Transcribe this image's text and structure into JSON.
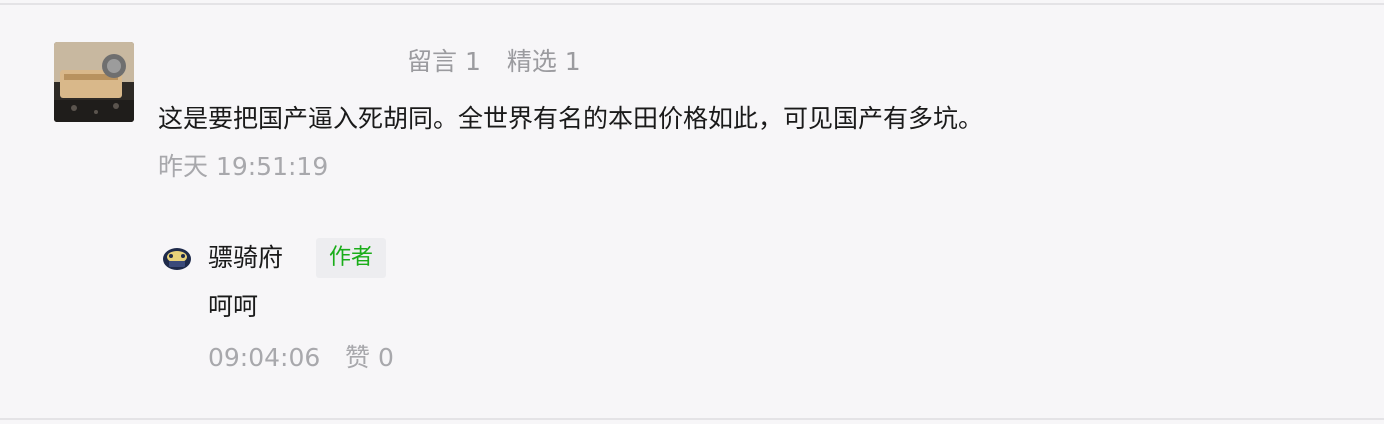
{
  "stats": {
    "comments_label": "留言 1",
    "featured_label": "精选 1"
  },
  "comment": {
    "avatar_icon": "user-avatar-photo-icon",
    "text": "这是要把国产逼入死胡同。全世界有名的本田价格如此，可见国产有多坑。",
    "time": "昨天 19:51:19"
  },
  "reply": {
    "avatar_icon": "author-avatar-badge-icon",
    "name": "骠骑府",
    "badge": "作者",
    "text": "呵呵",
    "time": "09:04:06",
    "like_label": "赞",
    "like_count": "0"
  },
  "colors": {
    "background": "#f7f6f8",
    "author_badge_text": "#1aad19",
    "muted_text": "#a8a8ac"
  }
}
